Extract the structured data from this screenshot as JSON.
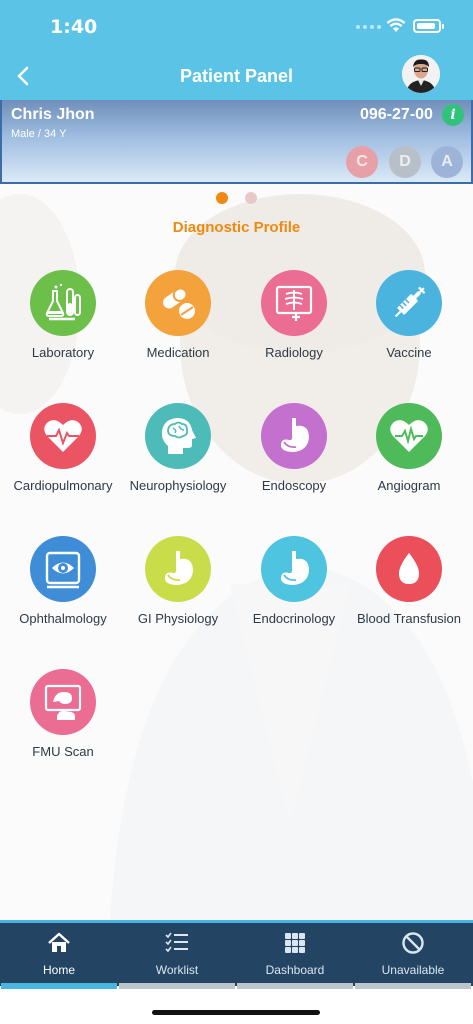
{
  "status": {
    "time": "1:40"
  },
  "nav": {
    "title": "Patient Panel"
  },
  "patient": {
    "name": "Chris Jhon",
    "meta": "Male / 34 Y",
    "id": "096-27-00",
    "info": "i",
    "badges": [
      {
        "label": "C",
        "color": "#e8a0a8"
      },
      {
        "label": "D",
        "color": "#b7bfc9"
      },
      {
        "label": "A",
        "color": "#9eb3d8"
      }
    ]
  },
  "pager": {
    "pages": 2,
    "active": 1,
    "active_color": "#f0890f",
    "inactive_color": "#e9c8c8"
  },
  "section": {
    "title": "Diagnostic Profile"
  },
  "tiles": [
    {
      "label": "Laboratory",
      "icon": "flask-icon",
      "color": "#6cc04a"
    },
    {
      "label": "Medication",
      "icon": "pills-icon",
      "color": "#f3a23c"
    },
    {
      "label": "Radiology",
      "icon": "xray-icon",
      "color": "#ec6d93"
    },
    {
      "label": "Vaccine",
      "icon": "syringe-icon",
      "color": "#4bb4de"
    },
    {
      "label": "Cardiopulmonary",
      "icon": "heart-pulse-icon",
      "color": "#ea5463"
    },
    {
      "label": "Neurophysiology",
      "icon": "brain-head-icon",
      "color": "#4dbcb8"
    },
    {
      "label": "Endoscopy",
      "icon": "stomach-icon",
      "color": "#c470cf"
    },
    {
      "label": "Angiogram",
      "icon": "heart-monitor-icon",
      "color": "#4fba5a"
    },
    {
      "label": "Ophthalmology",
      "icon": "eye-scan-icon",
      "color": "#3f8dd6"
    },
    {
      "label": "GI Physiology",
      "icon": "stomach-icon",
      "color": "#c9dd4a"
    },
    {
      "label": "Endocrinology",
      "icon": "stomach-icon",
      "color": "#4fc4e0"
    },
    {
      "label": "Blood Transfusion",
      "icon": "blood-drop-icon",
      "color": "#ea4f5a"
    },
    {
      "label": "FMU Scan",
      "icon": "ultrasound-icon",
      "color": "#ec6d93"
    }
  ],
  "tabs": [
    {
      "label": "Home",
      "icon": "home-icon",
      "active": true
    },
    {
      "label": "Worklist",
      "icon": "checklist-icon",
      "active": false
    },
    {
      "label": "Dashboard",
      "icon": "grid-icon",
      "active": false
    },
    {
      "label": "Unavailable",
      "icon": "block-icon",
      "active": false
    }
  ]
}
